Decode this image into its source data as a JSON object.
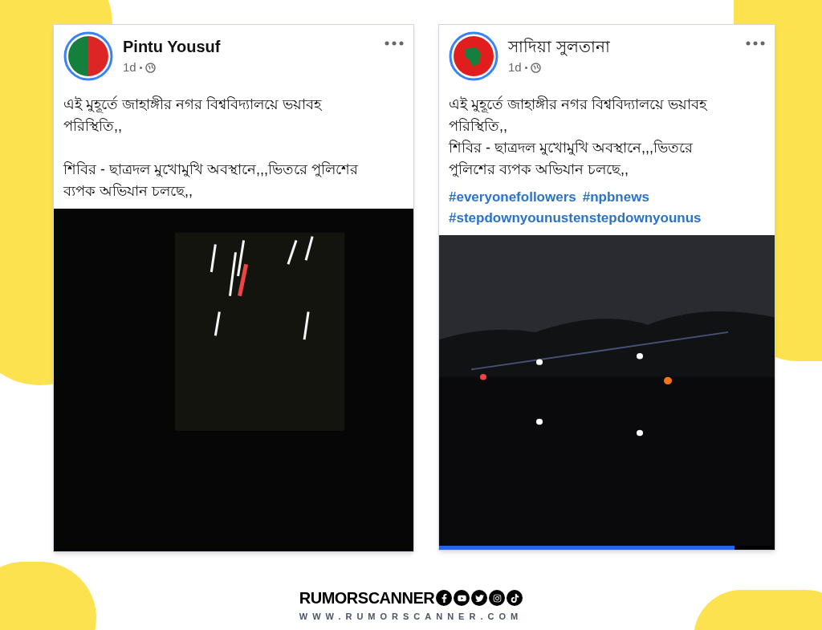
{
  "posts": [
    {
      "author": "Pintu Yousuf",
      "author_bold": true,
      "time": "1d",
      "spaced": true,
      "paragraphs": [
        "এই মুহূর্তে জাহাঙ্গীর নগর বিশ্ববিদ্যালয়ে ভয়াবহ পরিস্থিতি,,",
        "শিবির - ছাত্রদল মুখোমুখি অবস্থানে,,,ভিতরে পুলিশের ব্যপক অভিযান চলছে,,"
      ],
      "shows_lights": true
    },
    {
      "author": "সাদিয়া সুলতানা",
      "author_bold": false,
      "time": "1d",
      "spaced": false,
      "paragraphs": [
        "এই মুহূর্তে জাহাঙ্গীর নগর বিশ্ববিদ্যালয়ে ভয়াবহ পরিস্থিতি,,",
        "শিবির - ছাত্রদল মুখোমুখি অবস্থানে,,,ভিতরে পুলিশের ব্যপক অভিযান চলছে,,"
      ],
      "hashtags": [
        "#everyonefollowers",
        "#npbnews",
        "#stepdownyounustenstepdownyounus"
      ],
      "shows_lights": false,
      "progress": {
        "level": 0.88
      }
    }
  ],
  "footer": {
    "brand": "RUMORSCANNER",
    "url": "WWW.RUMORSCANNER.COM"
  }
}
